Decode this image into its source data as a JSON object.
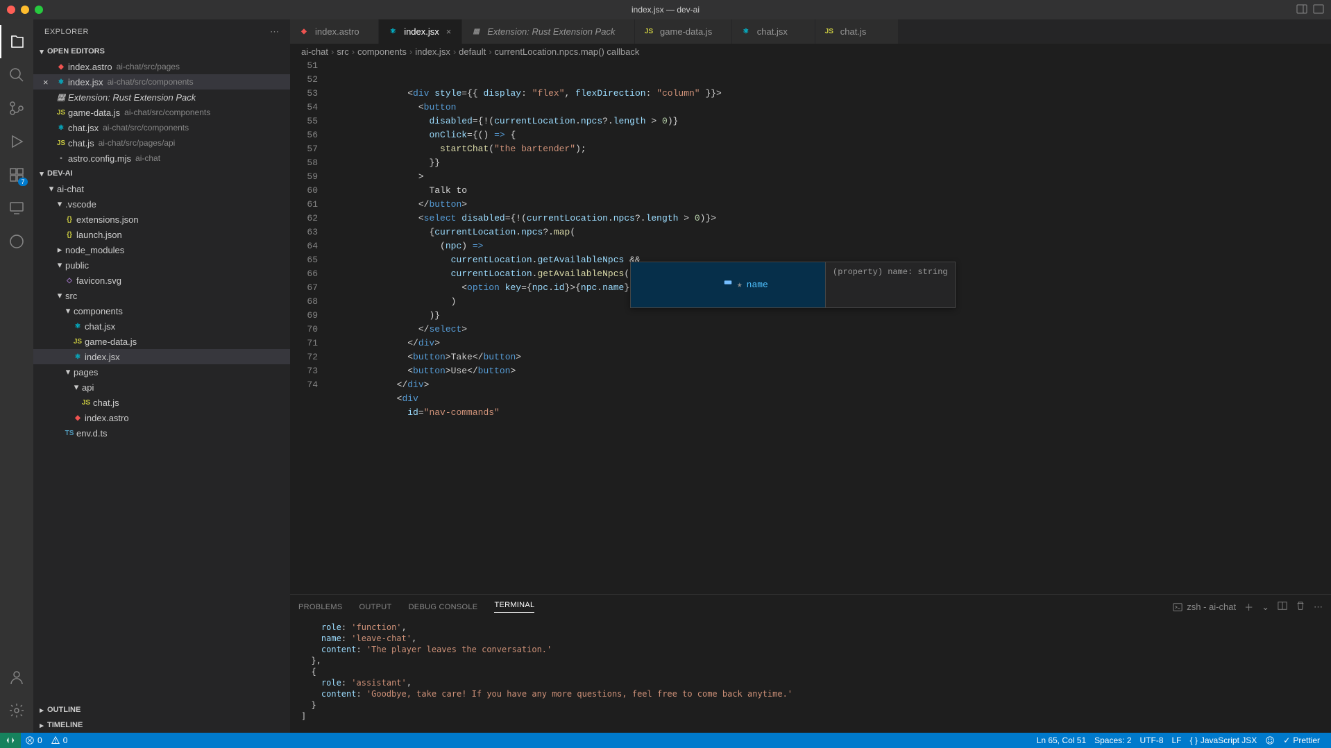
{
  "window": {
    "title": "index.jsx — dev-ai"
  },
  "explorer": {
    "title": "EXPLORER",
    "sections": {
      "openEditors": "OPEN EDITORS",
      "folder": "DEV-AI",
      "outline": "OUTLINE",
      "timeline": "TIMELINE"
    },
    "openEditors": [
      {
        "name": "index.astro",
        "path": "ai-chat/src/pages"
      },
      {
        "name": "index.jsx",
        "path": "ai-chat/src/components",
        "active": true
      },
      {
        "name": "Extension: Rust Extension Pack",
        "path": "",
        "italic": true
      },
      {
        "name": "game-data.js",
        "path": "ai-chat/src/components"
      },
      {
        "name": "chat.jsx",
        "path": "ai-chat/src/components"
      },
      {
        "name": "chat.js",
        "path": "ai-chat/src/pages/api"
      },
      {
        "name": "astro.config.mjs",
        "path": "ai-chat"
      }
    ],
    "tree": [
      {
        "depth": 0,
        "type": "folder",
        "name": "ai-chat",
        "open": true
      },
      {
        "depth": 1,
        "type": "folder",
        "name": ".vscode",
        "open": true
      },
      {
        "depth": 2,
        "type": "file",
        "name": "extensions.json",
        "icon": "json"
      },
      {
        "depth": 2,
        "type": "file",
        "name": "launch.json",
        "icon": "json"
      },
      {
        "depth": 1,
        "type": "folder",
        "name": "node_modules",
        "open": false
      },
      {
        "depth": 1,
        "type": "folder",
        "name": "public",
        "open": true
      },
      {
        "depth": 2,
        "type": "file",
        "name": "favicon.svg",
        "icon": "svg"
      },
      {
        "depth": 1,
        "type": "folder",
        "name": "src",
        "open": true
      },
      {
        "depth": 2,
        "type": "folder",
        "name": "components",
        "open": true
      },
      {
        "depth": 3,
        "type": "file",
        "name": "chat.jsx",
        "icon": "jsx"
      },
      {
        "depth": 3,
        "type": "file",
        "name": "game-data.js",
        "icon": "js"
      },
      {
        "depth": 3,
        "type": "file",
        "name": "index.jsx",
        "icon": "jsx",
        "selected": true
      },
      {
        "depth": 2,
        "type": "folder",
        "name": "pages",
        "open": true
      },
      {
        "depth": 3,
        "type": "folder",
        "name": "api",
        "open": true
      },
      {
        "depth": 4,
        "type": "file",
        "name": "chat.js",
        "icon": "js"
      },
      {
        "depth": 3,
        "type": "file",
        "name": "index.astro",
        "icon": "astro"
      },
      {
        "depth": 2,
        "type": "file",
        "name": "env.d.ts",
        "icon": "ts"
      }
    ]
  },
  "tabs": [
    {
      "name": "index.astro",
      "icon": "astro"
    },
    {
      "name": "index.jsx",
      "icon": "jsx",
      "active": true,
      "dirty": false
    },
    {
      "name": "Extension: Rust Extension Pack",
      "icon": "ext",
      "italic": true
    },
    {
      "name": "game-data.js",
      "icon": "js"
    },
    {
      "name": "chat.jsx",
      "icon": "jsx"
    },
    {
      "name": "chat.js",
      "icon": "js"
    }
  ],
  "breadcrumbs": [
    "ai-chat",
    "src",
    "components",
    "index.jsx",
    "default",
    "currentLocation.npcs.map() callback"
  ],
  "codeLines": [
    {
      "n": 51,
      "html": "<span class='tok-pun'>&lt;</span><span class='tok-tag'>div</span> <span class='tok-attr'>style</span><span class='tok-pun'>={{</span> <span class='tok-attr'>display</span><span class='tok-pun'>:</span> <span class='tok-str'>\"flex\"</span><span class='tok-pun'>,</span> <span class='tok-attr'>flexDirection</span><span class='tok-pun'>:</span> <span class='tok-str'>\"column\"</span> <span class='tok-pun'>}}&gt;</span>",
      "indent": 14
    },
    {
      "n": 52,
      "html": "<span class='tok-pun'>&lt;</span><span class='tok-tag'>button</span>",
      "indent": 16
    },
    {
      "n": 53,
      "html": "<span class='tok-attr'>disabled</span><span class='tok-pun'>={!(</span><span class='tok-var'>currentLocation</span><span class='tok-pun'>.</span><span class='tok-var'>npcs</span><span class='tok-pun'>?.</span><span class='tok-var'>length</span> <span class='tok-pun'>&gt;</span> <span class='tok-num'>0</span><span class='tok-pun'>)}</span>",
      "indent": 18
    },
    {
      "n": 54,
      "html": "<span class='tok-attr'>onClick</span><span class='tok-pun'>={</span><span class='tok-pun'>() </span><span class='tok-tag'>=&gt;</span><span class='tok-pun'> {</span>",
      "indent": 18
    },
    {
      "n": 55,
      "html": "<span class='tok-fn'>startChat</span><span class='tok-pun'>(</span><span class='tok-str'>\"the bartender\"</span><span class='tok-pun'>);</span>",
      "indent": 20
    },
    {
      "n": 56,
      "html": "<span class='tok-pun'>}}</span>",
      "indent": 18
    },
    {
      "n": 57,
      "html": "<span class='tok-pun'>&gt;</span>",
      "indent": 16
    },
    {
      "n": 58,
      "html": "<span class='tok-pun'>Talk to</span>",
      "indent": 18
    },
    {
      "n": 59,
      "html": "<span class='tok-pun'>&lt;/</span><span class='tok-tag'>button</span><span class='tok-pun'>&gt;</span>",
      "indent": 16
    },
    {
      "n": 60,
      "html": "<span class='tok-pun'>&lt;</span><span class='tok-tag'>select</span> <span class='tok-attr'>disabled</span><span class='tok-pun'>={!(</span><span class='tok-var'>currentLocation</span><span class='tok-pun'>.</span><span class='tok-var'>npcs</span><span class='tok-pun'>?.</span><span class='tok-var'>length</span> <span class='tok-pun'>&gt;</span> <span class='tok-num'>0</span><span class='tok-pun'>)}&gt;</span>",
      "indent": 16
    },
    {
      "n": 61,
      "html": "<span class='tok-pun'>{</span><span class='tok-var'>currentLocation</span><span class='tok-pun'>.</span><span class='tok-var'>npcs</span><span class='tok-pun'>?.</span><span class='tok-fn'>map</span><span class='tok-pun'>(</span>",
      "indent": 18
    },
    {
      "n": 62,
      "html": "<span class='tok-pun'>(</span><span class='tok-var'>npc</span><span class='tok-pun'>)</span> <span class='tok-tag'>=&gt;</span>",
      "indent": 20
    },
    {
      "n": 63,
      "html": "<span class='tok-var'>currentLocation</span><span class='tok-pun'>.</span><span class='tok-var'>getAvailableNpcs</span> <span class='tok-pun'>&amp;&amp;</span>",
      "indent": 22
    },
    {
      "n": 64,
      "html": "<span class='tok-var'>currentLocation</span><span class='tok-pun'>.</span><span class='tok-fn'>getAvailableNpcs</span><span class='tok-pun'>(</span><span class='tok-var'>gameRuntimeData</span><span class='tok-pun'>).</span><span class='tok-fn'>includes</span><span class='tok-pun'>(</span><span class='tok-var'>npc</span><span class='tok-pun'>.</span><span class='tok-var'>id</span><span class='tok-pun'>) &amp;&amp; (</span>",
      "indent": 22
    },
    {
      "n": 65,
      "html": "<span class='tok-pun'>&lt;</span><span class='tok-tag'>option</span> <span class='tok-attr'>key</span><span class='tok-pun'>={</span><span class='tok-var'>npc</span><span class='tok-pun'>.</span><span class='tok-var'>id</span><span class='tok-pun'>}&gt;{</span><span class='tok-var'>npc</span><span class='tok-pun'>.</span><span class='tok-var'>name</span><span class='tok-pun'>}&lt;/</span><span class='tok-tag'>option</span><span class='tok-pun'>&gt;</span>",
      "indent": 24
    },
    {
      "n": 66,
      "html": "<span class='tok-pun'>)</span>",
      "indent": 22
    },
    {
      "n": 67,
      "html": "<span class='tok-pun'>)}</span>",
      "indent": 18
    },
    {
      "n": 68,
      "html": "<span class='tok-pun'>&lt;/</span><span class='tok-tag'>select</span><span class='tok-pun'>&gt;</span>",
      "indent": 16
    },
    {
      "n": 69,
      "html": "<span class='tok-pun'>&lt;/</span><span class='tok-tag'>div</span><span class='tok-pun'>&gt;</span>",
      "indent": 14
    },
    {
      "n": 70,
      "html": "<span class='tok-pun'>&lt;</span><span class='tok-tag'>button</span><span class='tok-pun'>&gt;</span>Take<span class='tok-pun'>&lt;/</span><span class='tok-tag'>button</span><span class='tok-pun'>&gt;</span>",
      "indent": 14
    },
    {
      "n": 71,
      "html": "<span class='tok-pun'>&lt;</span><span class='tok-tag'>button</span><span class='tok-pun'>&gt;</span>Use<span class='tok-pun'>&lt;/</span><span class='tok-tag'>button</span><span class='tok-pun'>&gt;</span>",
      "indent": 14
    },
    {
      "n": 72,
      "html": "<span class='tok-pun'>&lt;/</span><span class='tok-tag'>div</span><span class='tok-pun'>&gt;</span>",
      "indent": 12
    },
    {
      "n": 73,
      "html": "<span class='tok-pun'>&lt;</span><span class='tok-tag'>div</span>",
      "indent": 12
    },
    {
      "n": 74,
      "html": "<span class='tok-attr'>id</span><span class='tok-pun'>=</span><span class='tok-str'>\"nav-commands\"</span>",
      "indent": 14
    }
  ],
  "suggest": {
    "item": "name",
    "star": "★",
    "detail": "(property) name: string"
  },
  "panel": {
    "tabs": [
      "PROBLEMS",
      "OUTPUT",
      "DEBUG CONSOLE",
      "TERMINAL"
    ],
    "activeTab": 3,
    "shell": "zsh - ai-chat",
    "terminal": "    role: 'function',\n    name: 'leave-chat',\n    content: 'The player leaves the conversation.'\n  },\n  {\n    role: 'assistant',\n    content: 'Goodbye, take care! If you have any more questions, feel free to come back anytime.'\n  }\n]"
  },
  "statusbar": {
    "errors": "0",
    "warnings": "0",
    "cursor": "Ln 65, Col 51",
    "spaces": "Spaces: 2",
    "encoding": "UTF-8",
    "eol": "LF",
    "language": "JavaScript JSX",
    "prettier": "Prettier"
  },
  "activityBadge": "7"
}
